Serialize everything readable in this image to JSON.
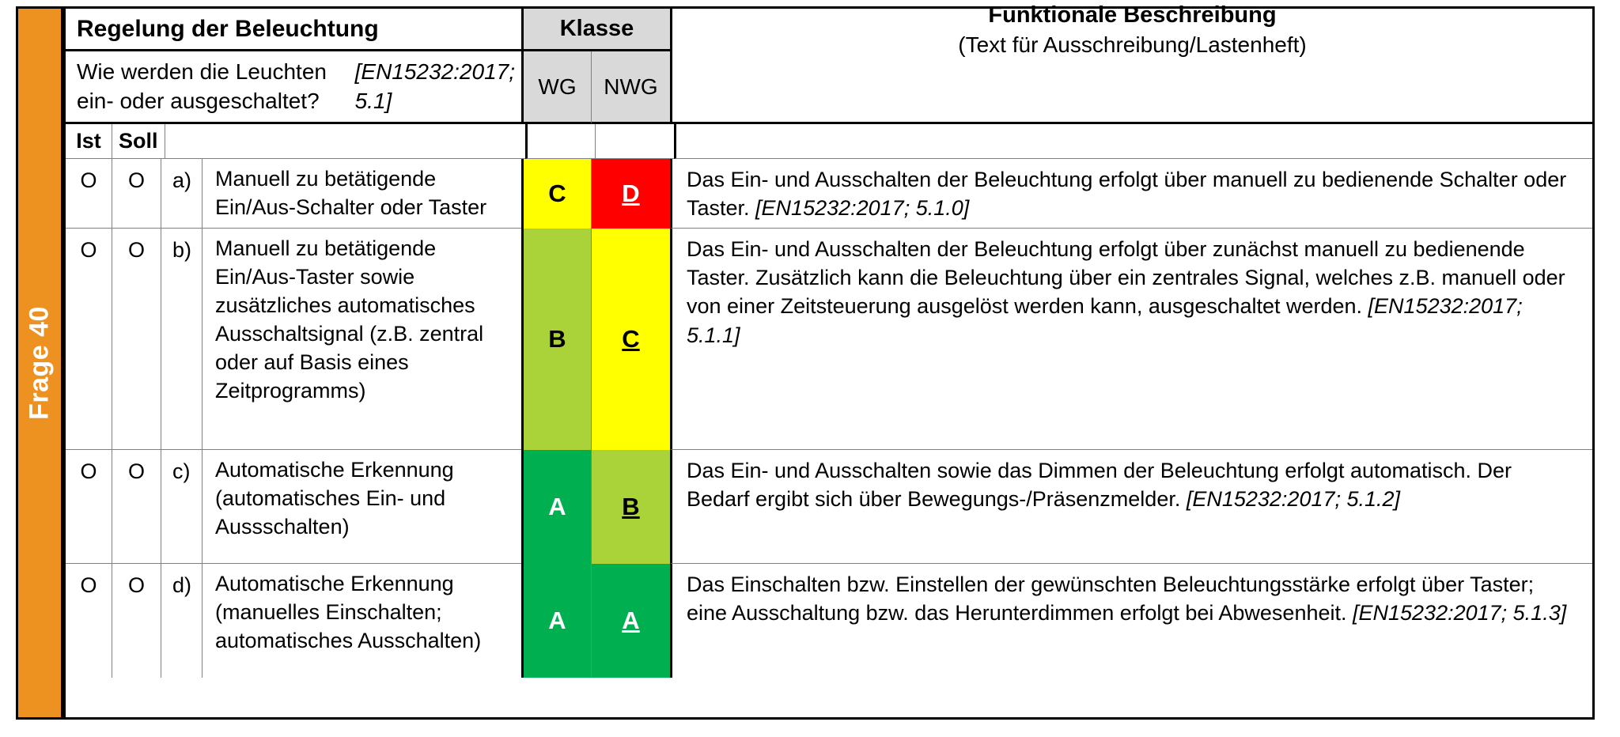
{
  "question": {
    "tab_label": "Frage 40"
  },
  "header": {
    "section_title": "Regelung der Beleuchtung",
    "question_text": "Wie werden die Leuchten ein- oder ausgeschaltet? ",
    "question_ref": "[EN15232:2017; 5.1]",
    "klasse_label": "Klasse",
    "wg_label": "WG",
    "nwg_label": "NWG",
    "func_title": "Funktionale Beschreibung",
    "func_subtitle": "(Text für Ausschreibung/Lastenheft)",
    "ist_label": "Ist",
    "soll_label": "Soll"
  },
  "colors": {
    "tab_orange": "#ED9121",
    "header_gray": "#D9D9D9",
    "class_a": "#00B050",
    "class_b": "#A9D339",
    "class_c": "#FFFF00",
    "class_d": "#FF0000"
  },
  "rows": [
    {
      "ist": "O",
      "soll": "O",
      "letter": "a)",
      "option": "Manuell zu betätigende Ein/Aus-Schalter oder Taster",
      "wg": "C",
      "wg_color": "#FFFF00",
      "wg_text_color": "#000000",
      "nwg": "D",
      "nwg_color": "#FF0000",
      "nwg_text_color": "#FFFFFF",
      "description": "Das Ein- und Ausschalten der Beleuchtung erfolgt über manuell zu bedienende Schalter oder Taster. ",
      "reference": "[EN15232:2017; 5.1.0]"
    },
    {
      "ist": "O",
      "soll": "O",
      "letter": "b)",
      "option": "Manuell zu betätigende Ein/Aus-Taster sowie zusätzliches automatisches Ausschaltsignal (z.B. zentral oder auf Basis eines Zeitprogramms)",
      "wg": "B",
      "wg_color": "#A9D339",
      "wg_text_color": "#000000",
      "nwg": "C",
      "nwg_color": "#FFFF00",
      "nwg_text_color": "#000000",
      "description": "Das Ein- und Ausschalten der Beleuchtung erfolgt über zunächst manuell zu bedienende Taster. Zusätzlich kann die Beleuchtung über ein zentrales Signal, welches z.B. manuell oder von einer Zeitsteuerung ausgelöst werden kann, ausgeschaltet werden. ",
      "reference": "[EN15232:2017; 5.1.1]"
    },
    {
      "ist": "O",
      "soll": "O",
      "letter": "c)",
      "option": "Automatische Erkennung (automatisches Ein- und Aussschalten)",
      "wg": "A",
      "wg_color": "#00B050",
      "wg_text_color": "#FFFFFF",
      "nwg": "B",
      "nwg_color": "#A9D339",
      "nwg_text_color": "#000000",
      "description": "Das Ein- und Ausschalten sowie das Dimmen der Beleuchtung erfolgt automatisch. Der Bedarf ergibt sich über Bewegungs-/Präsenzmelder. ",
      "reference": "[EN15232:2017; 5.1.2]"
    },
    {
      "ist": "O",
      "soll": "O",
      "letter": "d)",
      "option": "Automatische Erkennung (manuelles Einschalten; automatisches Ausschalten)",
      "wg": "A",
      "wg_color": "#00B050",
      "wg_text_color": "#FFFFFF",
      "nwg": "A",
      "nwg_color": "#00B050",
      "nwg_text_color": "#FFFFFF",
      "description": "Das Einschalten bzw. Einstellen der gewünschten Beleuchtungsstärke erfolgt über Taster; eine Ausschaltung bzw. das Herunterdimmen erfolgt bei Abwesenheit. ",
      "reference": "[EN15232:2017; 5.1.3]"
    }
  ]
}
